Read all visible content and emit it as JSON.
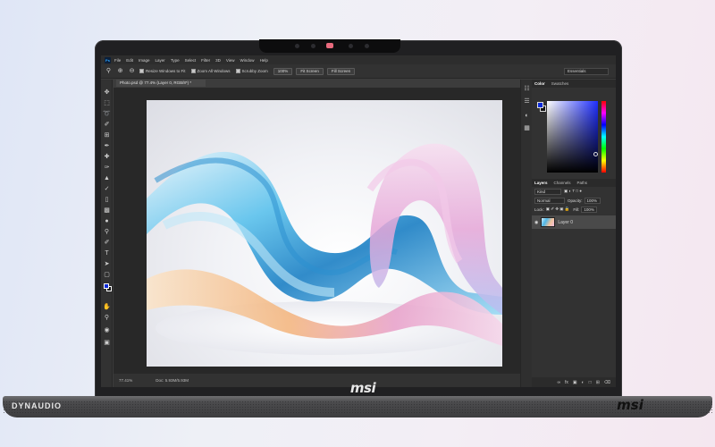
{
  "menubar": {
    "app_icon_label": "Ps",
    "items": [
      "File",
      "Edit",
      "Image",
      "Layer",
      "Type",
      "Select",
      "Filter",
      "3D",
      "View",
      "Window",
      "Help"
    ]
  },
  "options_bar": {
    "resize_windows_label": "Resize Windows to Fit",
    "zoom_all_windows_label": "Zoom All Windows",
    "scrubby_zoom_label": "Scrubby Zoom",
    "zoom_100_label": "100%",
    "fit_screen_label": "Fit Screen",
    "fill_screen_label": "Fill Screen",
    "workspace_label": "Essentials"
  },
  "document": {
    "tab_title": "Photo.psd @ 77.4% (Layer 0, RGB/8*) *"
  },
  "status_bar": {
    "zoom": "77.41%",
    "doc_info": "Doc: 5.93M/5.93M"
  },
  "color_panel": {
    "tabs": [
      "Color",
      "Swatches"
    ],
    "foreground_color": "#0c2bd8",
    "background_color": "#111111"
  },
  "layers_panel": {
    "tabs": [
      "Layers",
      "Channels",
      "Paths"
    ],
    "filter_label": "Kind",
    "blend_mode": "Normal",
    "opacity_label": "Opacity:",
    "opacity_value": "100%",
    "lock_label": "Lock:",
    "fill_label": "Fill:",
    "fill_value": "100%",
    "layers": [
      {
        "name": "Layer 0",
        "visible": true
      }
    ]
  },
  "hardware": {
    "bezel_logo": "msi",
    "base_logo": "msi",
    "speaker_brand": "DYNAUDIO"
  }
}
